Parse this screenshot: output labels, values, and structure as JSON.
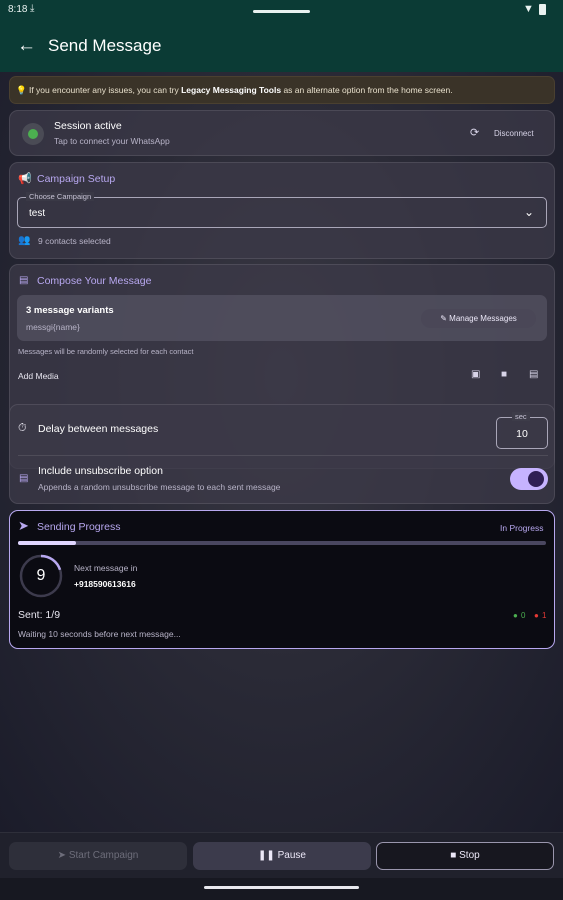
{
  "status_bar": {
    "time": "8:18"
  },
  "appbar": {
    "title": "Send Message"
  },
  "notice": {
    "pre": "If you encounter any issues, you can try ",
    "bold": "Legacy Messaging Tools",
    "post": " as an alternate option from the home screen."
  },
  "session": {
    "title": "Session active",
    "subtitle": "Tap to connect your WhatsApp",
    "disconnect_label": "Disconnect"
  },
  "campaign": {
    "title": "Campaign Setup",
    "field_label": "Choose Campaign",
    "field_value": "test",
    "contacts": "9 contacts selected"
  },
  "compose": {
    "title": "Compose Your Message",
    "variants": "3 message variants",
    "preview": "messgi{name}",
    "manage_label": "Manage Messages",
    "note": "Messages will be randomly selected for each contact",
    "add_media": "Add Media"
  },
  "settings": {
    "delay_label": "Delay between messages",
    "sec_label": "sec",
    "sec_value": "10",
    "unsub_title": "Include unsubscribe option",
    "unsub_sub": "Appends a random unsubscribe message to each sent message",
    "unsub_enabled": true
  },
  "progress": {
    "title": "Sending Progress",
    "status": "In Progress",
    "fraction": 0.11,
    "countdown": "9",
    "next_label": "Next message in",
    "phone": "+918590613616",
    "sent": "Sent: 1/9",
    "ok_count": "0",
    "fail_count": "1",
    "waiting": "Waiting 10 seconds before next message..."
  },
  "bottom": {
    "start_label": "Start Campaign",
    "pause_label": "Pause",
    "stop_label": "Stop"
  },
  "colors": {
    "accent": "#b8a8f0",
    "success": "#4caf50",
    "error": "#e53935",
    "toggle_on": "#c6b3ff"
  }
}
